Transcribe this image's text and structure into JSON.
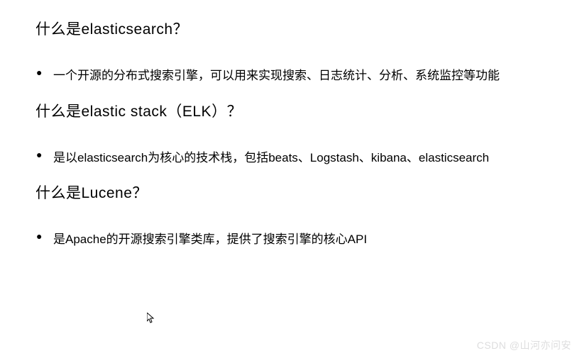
{
  "sections": [
    {
      "heading": "什么是elasticsearch？",
      "bullet": "一个开源的分布式搜索引擎，可以用来实现搜索、日志统计、分析、系统监控等功能"
    },
    {
      "heading": "什么是elastic stack（ELK）？",
      "bullet": "是以elasticsearch为核心的技术栈，包括beats、Logstash、kibana、elasticsearch"
    },
    {
      "heading": "什么是Lucene？",
      "bullet": "是Apache的开源搜索引擎类库，提供了搜索引擎的核心API"
    }
  ],
  "watermark": "CSDN @山河亦问安"
}
